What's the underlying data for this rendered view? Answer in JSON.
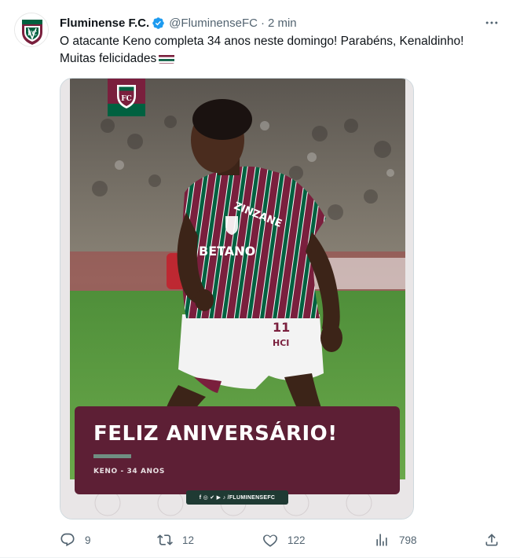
{
  "tweet": {
    "author_name": "Fluminense F.C.",
    "handle": "@FluminenseFC",
    "separator": "·",
    "time": "2 min",
    "text_line1": "O atacante Keno completa 34 anos neste domingo! Parabéns, Kenaldinho!",
    "text_line2": "Muitas felicidades"
  },
  "media": {
    "headline": "FELIZ ANIVERSÁRIO!",
    "subline": "KENO - 34 ANOS",
    "social_handle": "f ◎ ✔ ▶ ♪ /FLUMINENSEFC",
    "jersey_sponsor": "BETANO",
    "jersey_number": "11",
    "sleeve_text": "ZINZANE",
    "short_sponsor": "HCI"
  },
  "actions": {
    "replies": "9",
    "retweets": "12",
    "likes": "122",
    "views": "798"
  },
  "colors": {
    "grena": "#7a1f3d",
    "green": "#006140",
    "card": "#5d1f35",
    "verified": "#1d9bf0",
    "muted": "#536471"
  }
}
